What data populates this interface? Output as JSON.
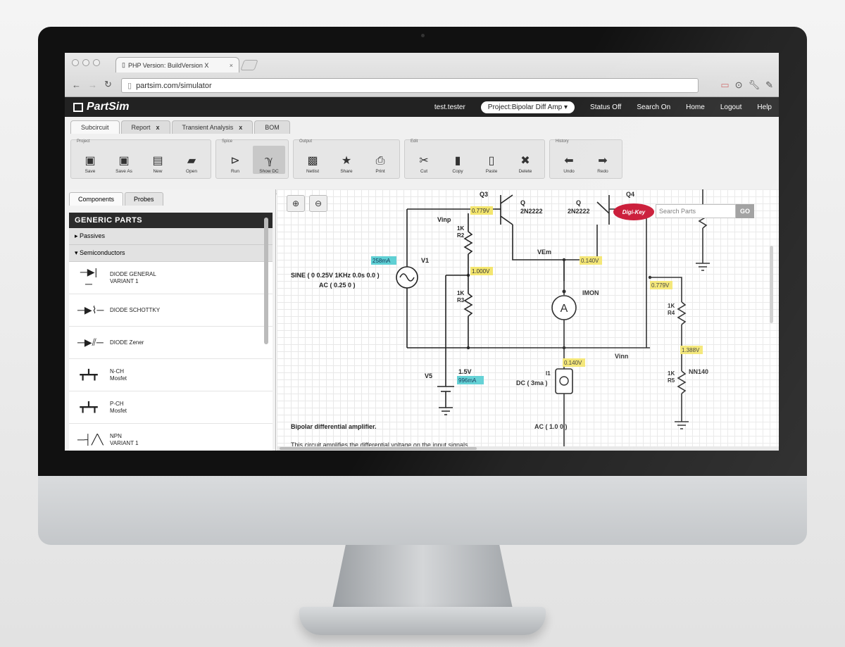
{
  "browser": {
    "tab_title": "PHP Version: BuildVersion X",
    "tab_close": "×",
    "url": "partsim.com/simulator"
  },
  "app": {
    "logo": "PartSim",
    "user": "test.tester",
    "project": "Project:Bipolar Diff Amp",
    "nav": [
      "Status Off",
      "Search On",
      "Home",
      "Logout",
      "Help"
    ]
  },
  "doc_tabs": [
    {
      "label": "Subcircuit",
      "close": ""
    },
    {
      "label": "Report",
      "close": "x"
    },
    {
      "label": "Transient Analysis",
      "close": "x"
    },
    {
      "label": "BOM",
      "close": ""
    }
  ],
  "toolbar": {
    "groups": [
      {
        "label": "Project",
        "buttons": [
          {
            "label": "Save",
            "icon": "save-icon"
          },
          {
            "label": "Save As",
            "icon": "save-as-icon"
          },
          {
            "label": "New",
            "icon": "new-icon"
          },
          {
            "label": "Open",
            "icon": "open-folder-icon"
          }
        ]
      },
      {
        "label": "Spice",
        "buttons": [
          {
            "label": "Run",
            "icon": "play-icon"
          },
          {
            "label": "Show DC",
            "icon": "show-dc-icon"
          }
        ]
      },
      {
        "label": "Output",
        "buttons": [
          {
            "label": "Netlist",
            "icon": "netlist-icon"
          },
          {
            "label": "Share",
            "icon": "star-icon"
          },
          {
            "label": "Print",
            "icon": "printer-icon"
          }
        ]
      },
      {
        "label": "Edit",
        "buttons": [
          {
            "label": "Cut",
            "icon": "scissors-icon"
          },
          {
            "label": "Copy",
            "icon": "copy-icon"
          },
          {
            "label": "Paste",
            "icon": "paste-icon"
          },
          {
            "label": "Delete",
            "icon": "delete-icon"
          }
        ]
      },
      {
        "label": "History",
        "buttons": [
          {
            "label": "Undo",
            "icon": "undo-arrow-icon"
          },
          {
            "label": "Redo",
            "icon": "redo-arrow-icon"
          }
        ]
      }
    ]
  },
  "sidebar": {
    "tabs": [
      "Components",
      "Probes"
    ],
    "header": "GENERIC PARTS",
    "categories": [
      "Passives",
      "Semiconductors"
    ],
    "parts": [
      {
        "name": "DIODE GENERAL",
        "sub": "VARIANT 1",
        "icon": "diode-icon"
      },
      {
        "name": "DIODE SCHOTTKY",
        "sub": "",
        "icon": "schottky-diode-icon"
      },
      {
        "name": "DIODE Zener",
        "sub": "",
        "icon": "zener-diode-icon"
      },
      {
        "name": "N-CH",
        "sub": "Mosfet",
        "icon": "nmos-icon"
      },
      {
        "name": "P-CH",
        "sub": "Mosfet",
        "icon": "pmos-icon"
      },
      {
        "name": "NPN",
        "sub": "VARIANT 1",
        "icon": "npn-transistor-icon"
      }
    ]
  },
  "canvas": {
    "search_placeholder": "Search Parts",
    "go_label": "GO",
    "digikey_label": "Digi-Key",
    "labels": {
      "q3": "Q3",
      "q3_model": "2N2222",
      "q3_type": "Q",
      "q4": "Q4",
      "q4_model": "2N2222",
      "q4_type": "Q",
      "vinp": "Vinp",
      "r2": "1K\nR2",
      "r3": "1K\nR3",
      "r4": "1K\nR4",
      "r5": "1K\nR5",
      "v1": "V1",
      "v1_sine": "SINE ( 0 0.25V 1KHz 0.0s 0.0 )",
      "v1_ac": "AC ( 0.25 0 )",
      "vem": "VEm",
      "imon": "IMON",
      "vinn": "Vinn",
      "nn140": "NN140",
      "v5": "V5",
      "v5_val": "1.5V",
      "i1": "I1",
      "i1_dc": "DC ( 3ma )",
      "i1_ac": "AC ( 1.0 0 )",
      "description": "Bipolar differential amplifier.",
      "description2": "This circuit amplifies the differential voltage on the input signals"
    },
    "probes": {
      "p1": "0.779V",
      "p2": "1.000V",
      "p3": "0.140V",
      "p4": "0.779V",
      "p5": "1.388V",
      "p6": "0.140V",
      "p7": "258mA",
      "p8": "996mA"
    }
  }
}
